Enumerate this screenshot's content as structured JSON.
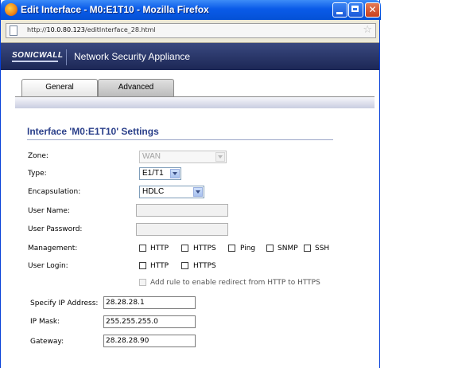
{
  "window": {
    "title": "Edit Interface - M0:E1T10 - Mozilla Firefox",
    "url_prefix": "http://",
    "url_host": "10.0.80.123",
    "url_path": "/editInterface_28.html"
  },
  "header": {
    "logo": "SONICWALL",
    "product": "Network Security Appliance"
  },
  "tabs": [
    {
      "label": "General",
      "active": true
    },
    {
      "label": "Advanced",
      "active": false
    }
  ],
  "section": {
    "title": "Interface 'M0:E1T10' Settings"
  },
  "form": {
    "zone_label": "Zone:",
    "zone_value": "WAN",
    "type_label": "Type:",
    "type_value": "E1/T1",
    "encapsulation_label": "Encapsulation:",
    "encapsulation_value": "HDLC",
    "username_label": "User Name:",
    "password_label": "User Password:",
    "management_label": "Management:",
    "management_options": [
      "HTTP",
      "HTTPS",
      "Ping",
      "SNMP",
      "SSH"
    ],
    "userlogin_label": "User Login:",
    "userlogin_options": [
      "HTTP",
      "HTTPS"
    ],
    "redirect_label": "Add rule to enable redirect from HTTP to HTTPS",
    "ip_label": "Specify IP Address:",
    "ip_value": "28.28.28.1",
    "mask_label": "IP Mask:",
    "mask_value": "255.255.255.0",
    "gateway_label": "Gateway:",
    "gateway_value": "28.28.28.90"
  },
  "colors": {
    "titlebar": "#0a5be8",
    "header": "#26336a",
    "section_title": "#2a3f8a"
  }
}
